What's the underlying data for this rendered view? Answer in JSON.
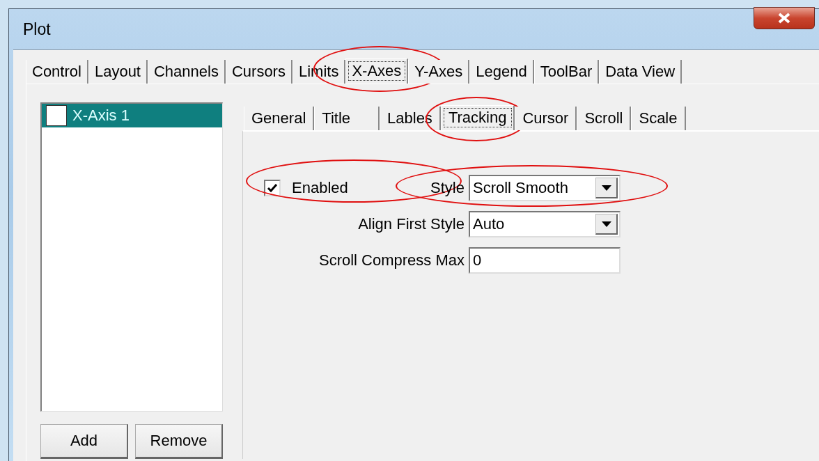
{
  "window": {
    "title": "Plot"
  },
  "tabs": [
    {
      "label": "Control",
      "selected": false,
      "circled": false
    },
    {
      "label": "Layout",
      "selected": false,
      "circled": false
    },
    {
      "label": "Channels",
      "selected": false,
      "circled": false
    },
    {
      "label": "Cursors",
      "selected": false,
      "circled": false
    },
    {
      "label": "Limits",
      "selected": false,
      "circled": false
    },
    {
      "label": "X-Axes",
      "selected": true,
      "circled": true
    },
    {
      "label": "Y-Axes",
      "selected": false,
      "circled": false
    },
    {
      "label": "Legend",
      "selected": false,
      "circled": false
    },
    {
      "label": "ToolBar",
      "selected": false,
      "circled": false
    },
    {
      "label": "Data View",
      "selected": false,
      "circled": false
    }
  ],
  "axis_list": {
    "items": [
      {
        "label": "X-Axis 1",
        "selected": true,
        "checked": false
      }
    ]
  },
  "buttons": [
    "Add",
    "Remove"
  ],
  "subtabs": [
    {
      "label": "General",
      "selected": false,
      "circled": false
    },
    {
      "label": "Title",
      "selected": false,
      "circled": false
    },
    {
      "label": "Lables",
      "selected": false,
      "circled": false
    },
    {
      "label": "Tracking",
      "selected": true,
      "circled": true
    },
    {
      "label": "Cursor",
      "selected": false,
      "circled": false
    },
    {
      "label": "Scroll",
      "selected": false,
      "circled": false
    },
    {
      "label": "Scale",
      "selected": false,
      "circled": false
    }
  ],
  "enabled": {
    "label": "Enabled",
    "checked": true,
    "circled": true
  },
  "fields": [
    {
      "label": "Style",
      "kind": "dropdown",
      "value": "Scroll Smooth",
      "circled": true
    },
    {
      "label": "Align First Style",
      "kind": "dropdown",
      "value": "Auto",
      "circled": false
    },
    {
      "label": "Scroll Compress Max",
      "kind": "text",
      "value": "0",
      "circled": false
    }
  ]
}
